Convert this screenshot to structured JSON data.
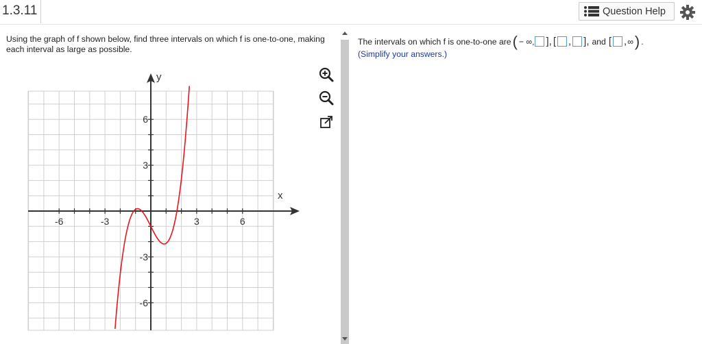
{
  "header": {
    "problem_number": "1.3.11",
    "help_label": "Question Help"
  },
  "question": {
    "text": "Using the graph of f shown below, find three intervals on which f is one-to-one, making each interval as large as possible."
  },
  "graph": {
    "x_axis_label": "x",
    "y_axis_label": "y",
    "x_ticks": [
      "-6",
      "-3",
      "3",
      "6"
    ],
    "y_ticks": [
      "6",
      "3",
      "-3",
      "-6"
    ],
    "curve_color": "#e8141a",
    "axis_color": "#333333",
    "grid_color": "#cfcfcf"
  },
  "answer": {
    "prefix": "The intervals on which f is one-to-one are",
    "neg_inf": "− ∞,",
    "and": "and",
    "pos_inf": "∞",
    "period": ".",
    "hint": "(Simplify your answers.)"
  },
  "tools": [
    "zoom-in-icon",
    "zoom-out-icon",
    "popout-icon"
  ],
  "colors": {
    "input_border": "#5b9bd5",
    "hint": "#1a3a9a",
    "curve": "#e8141a"
  }
}
